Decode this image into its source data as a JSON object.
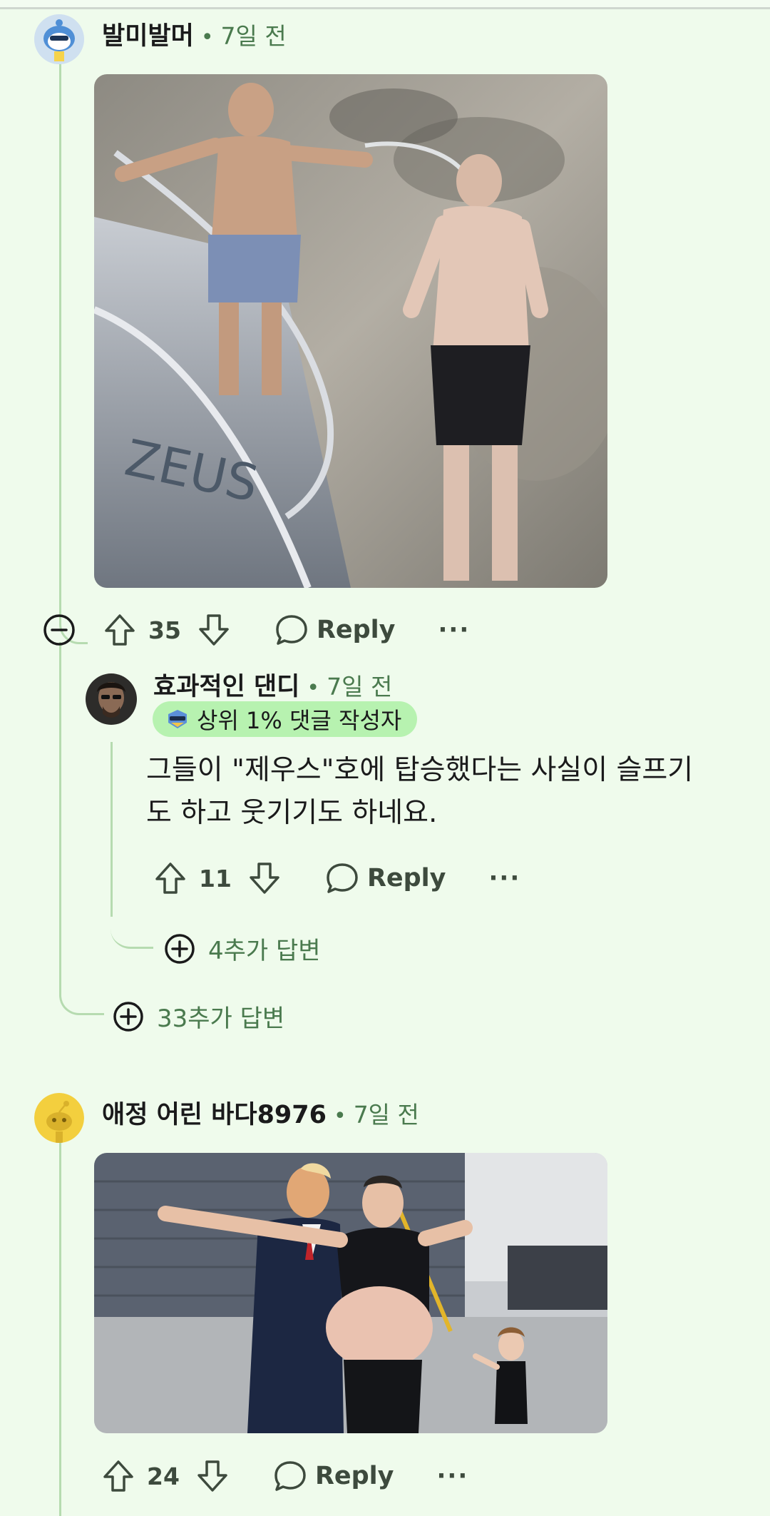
{
  "comments": [
    {
      "username": "발미발머",
      "time": "7일 전",
      "score": "35",
      "reply_label": "Reply",
      "avatar_icon": "snoo-blue-avatar-icon"
    },
    {
      "username": "효과적인 댄디",
      "time": "7일 전",
      "badge": "상위 1% 댓글 작성자",
      "badge_icon": "top-commenter-icon",
      "body": "그들이 \"제우스\"호에 탑승했다는 사실이 슬프기도 하고 웃기기도 하네요.",
      "body_line1": "그들이 \"제우스\"호에 탑승했다는 사실이 슬프기",
      "body_line2": "도 하고 웃기기도 하네요.",
      "score": "11",
      "reply_label": "Reply",
      "more_replies": "4추가 답변"
    },
    {
      "username": "애정 어린 바다8976",
      "time": "7일 전",
      "score": "24",
      "reply_label": "Reply",
      "avatar_icon": "snoo-yellow-avatar-icon"
    }
  ],
  "thread_more_replies": "33추가 답변",
  "separator": "•",
  "more_glyph": "···",
  "colors": {
    "background": "#effbec",
    "thread_line": "#b6dbb0",
    "meta_text": "#4a7a4e",
    "badge_bg": "#b7f2b0"
  }
}
